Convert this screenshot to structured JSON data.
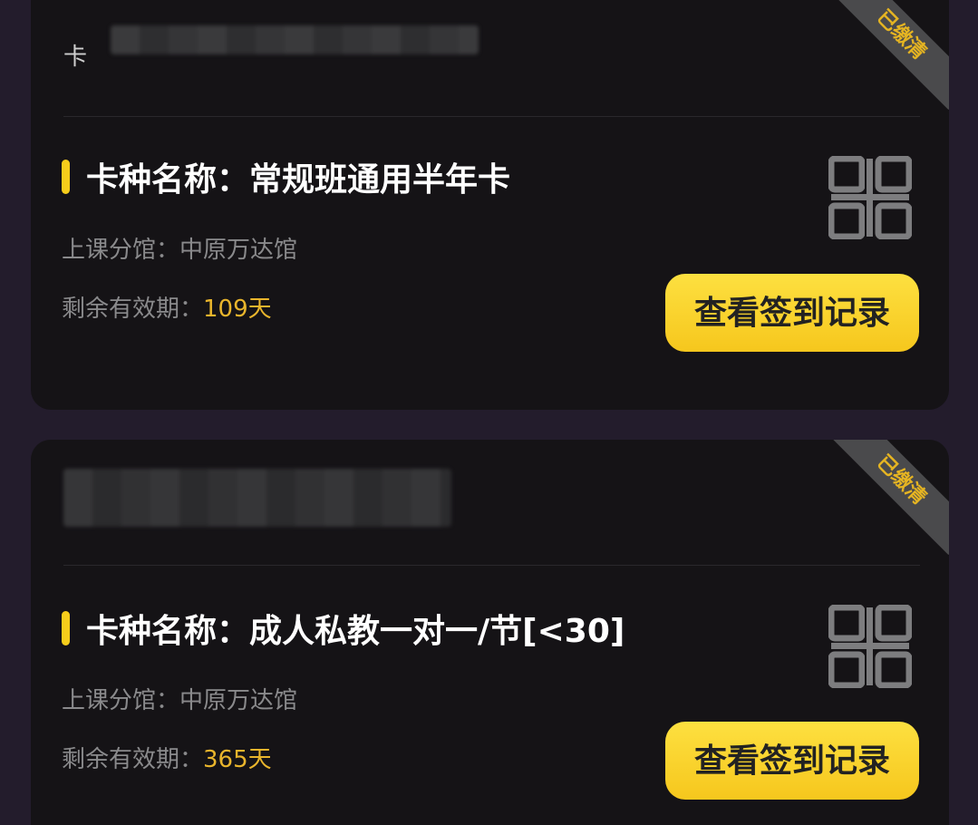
{
  "cards": [
    {
      "number_prefix": "卡",
      "badge": "已缴清",
      "card_type_label": "卡种名称：",
      "card_type_value": "常规班通用半年卡",
      "branch_label": "上课分馆：",
      "branch_value": "中原万达馆",
      "validity_label": "剩余有效期：",
      "validity_value": "109天",
      "button_label": "查看签到记录",
      "qr_icon": "qr-code-icon"
    },
    {
      "number_prefix": "",
      "badge": "已缴清",
      "card_type_label": "卡种名称：",
      "card_type_value": "成人私教一对一/节[<30]",
      "branch_label": "上课分馆：",
      "branch_value": "中原万达馆",
      "validity_label": "剩余有效期：",
      "validity_value": "365天",
      "button_label": "查看签到记录",
      "qr_icon": "qr-code-icon"
    }
  ],
  "colors": {
    "background": "#231c2c",
    "card": "#151316",
    "accent": "#f6cd1b",
    "gold_text": "#e9b52c",
    "badge_bg": "#4a4a4c"
  }
}
